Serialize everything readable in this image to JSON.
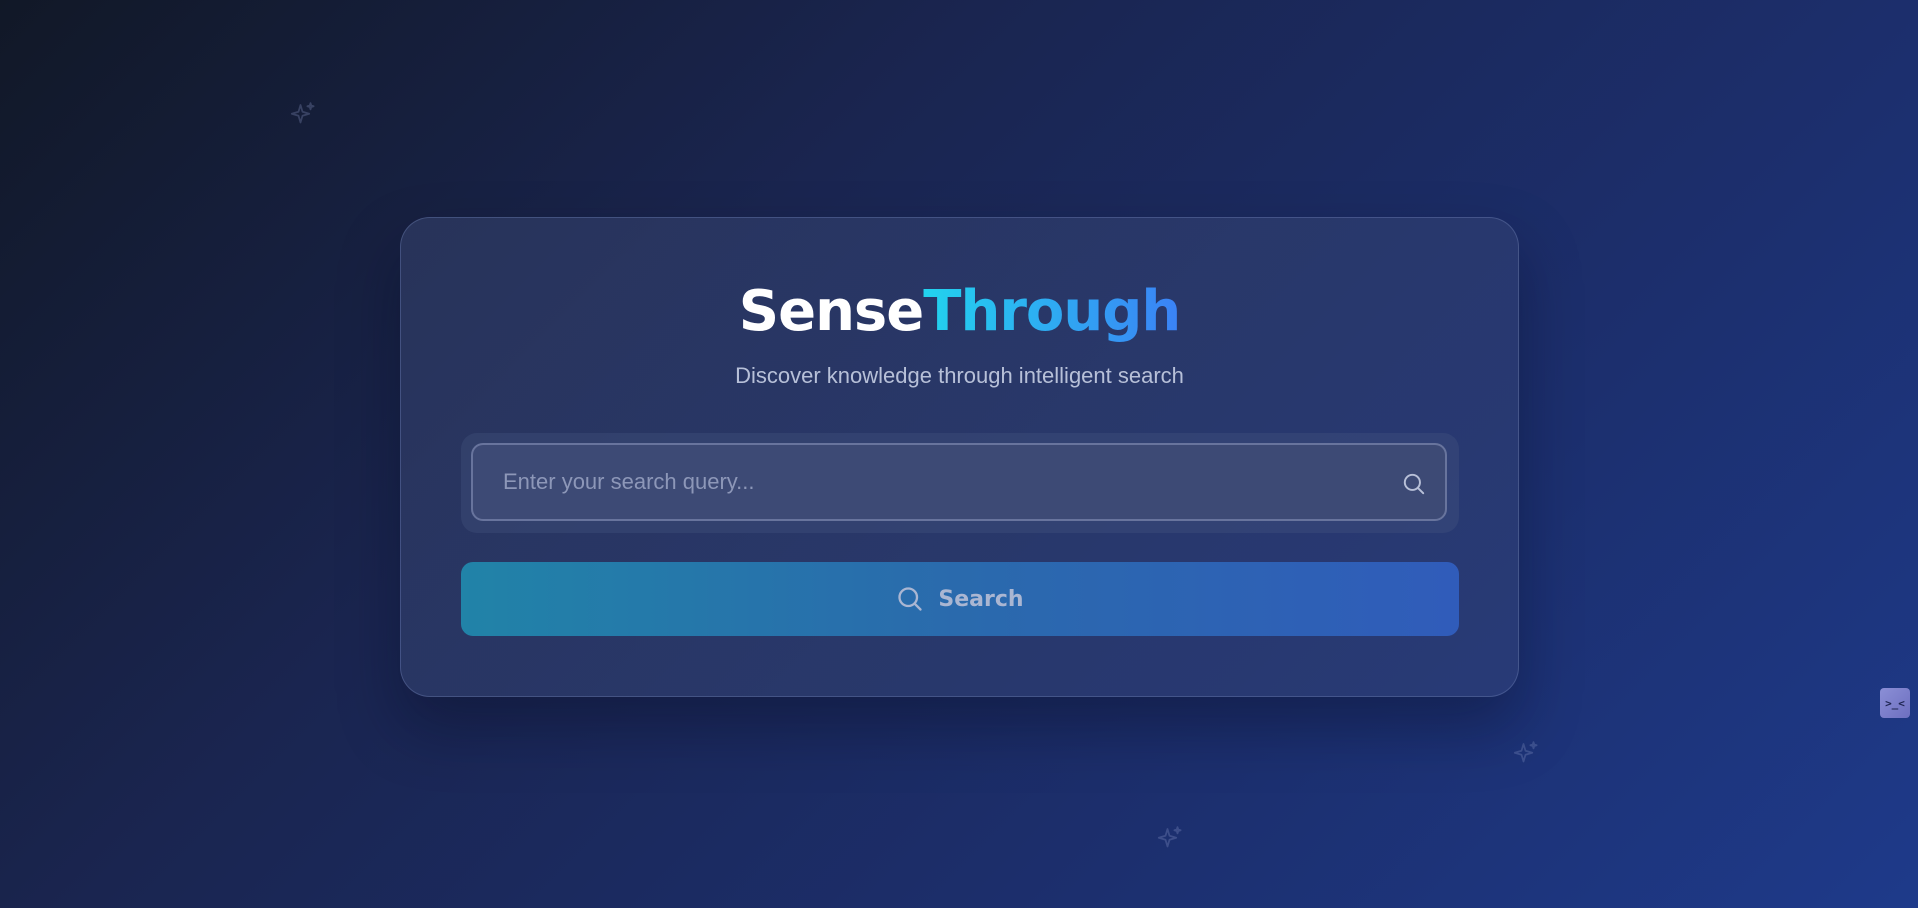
{
  "app": {
    "title_part1": "Sense",
    "title_part2": "Through",
    "subtitle": "Discover knowledge through intelligent search"
  },
  "search": {
    "placeholder": "Enter your search query...",
    "value": "",
    "icon": "search-icon"
  },
  "search_button": {
    "label": "Search",
    "icon": "search-icon"
  },
  "decorations": {
    "icons": [
      "sparkle-icon",
      "sparkle-icon",
      "sparkle-icon"
    ]
  },
  "widget": {
    "glyph": ">_<",
    "icon": "face-widget-icon"
  },
  "colors": {
    "background_start": "#111827",
    "background_end": "#1e3a8a",
    "title_white": "#ffffff",
    "title_gradient_start": "#22d3ee",
    "title_gradient_end": "#3b82f6",
    "button_gradient_start": "#2183a8",
    "button_gradient_end": "#305cba"
  }
}
